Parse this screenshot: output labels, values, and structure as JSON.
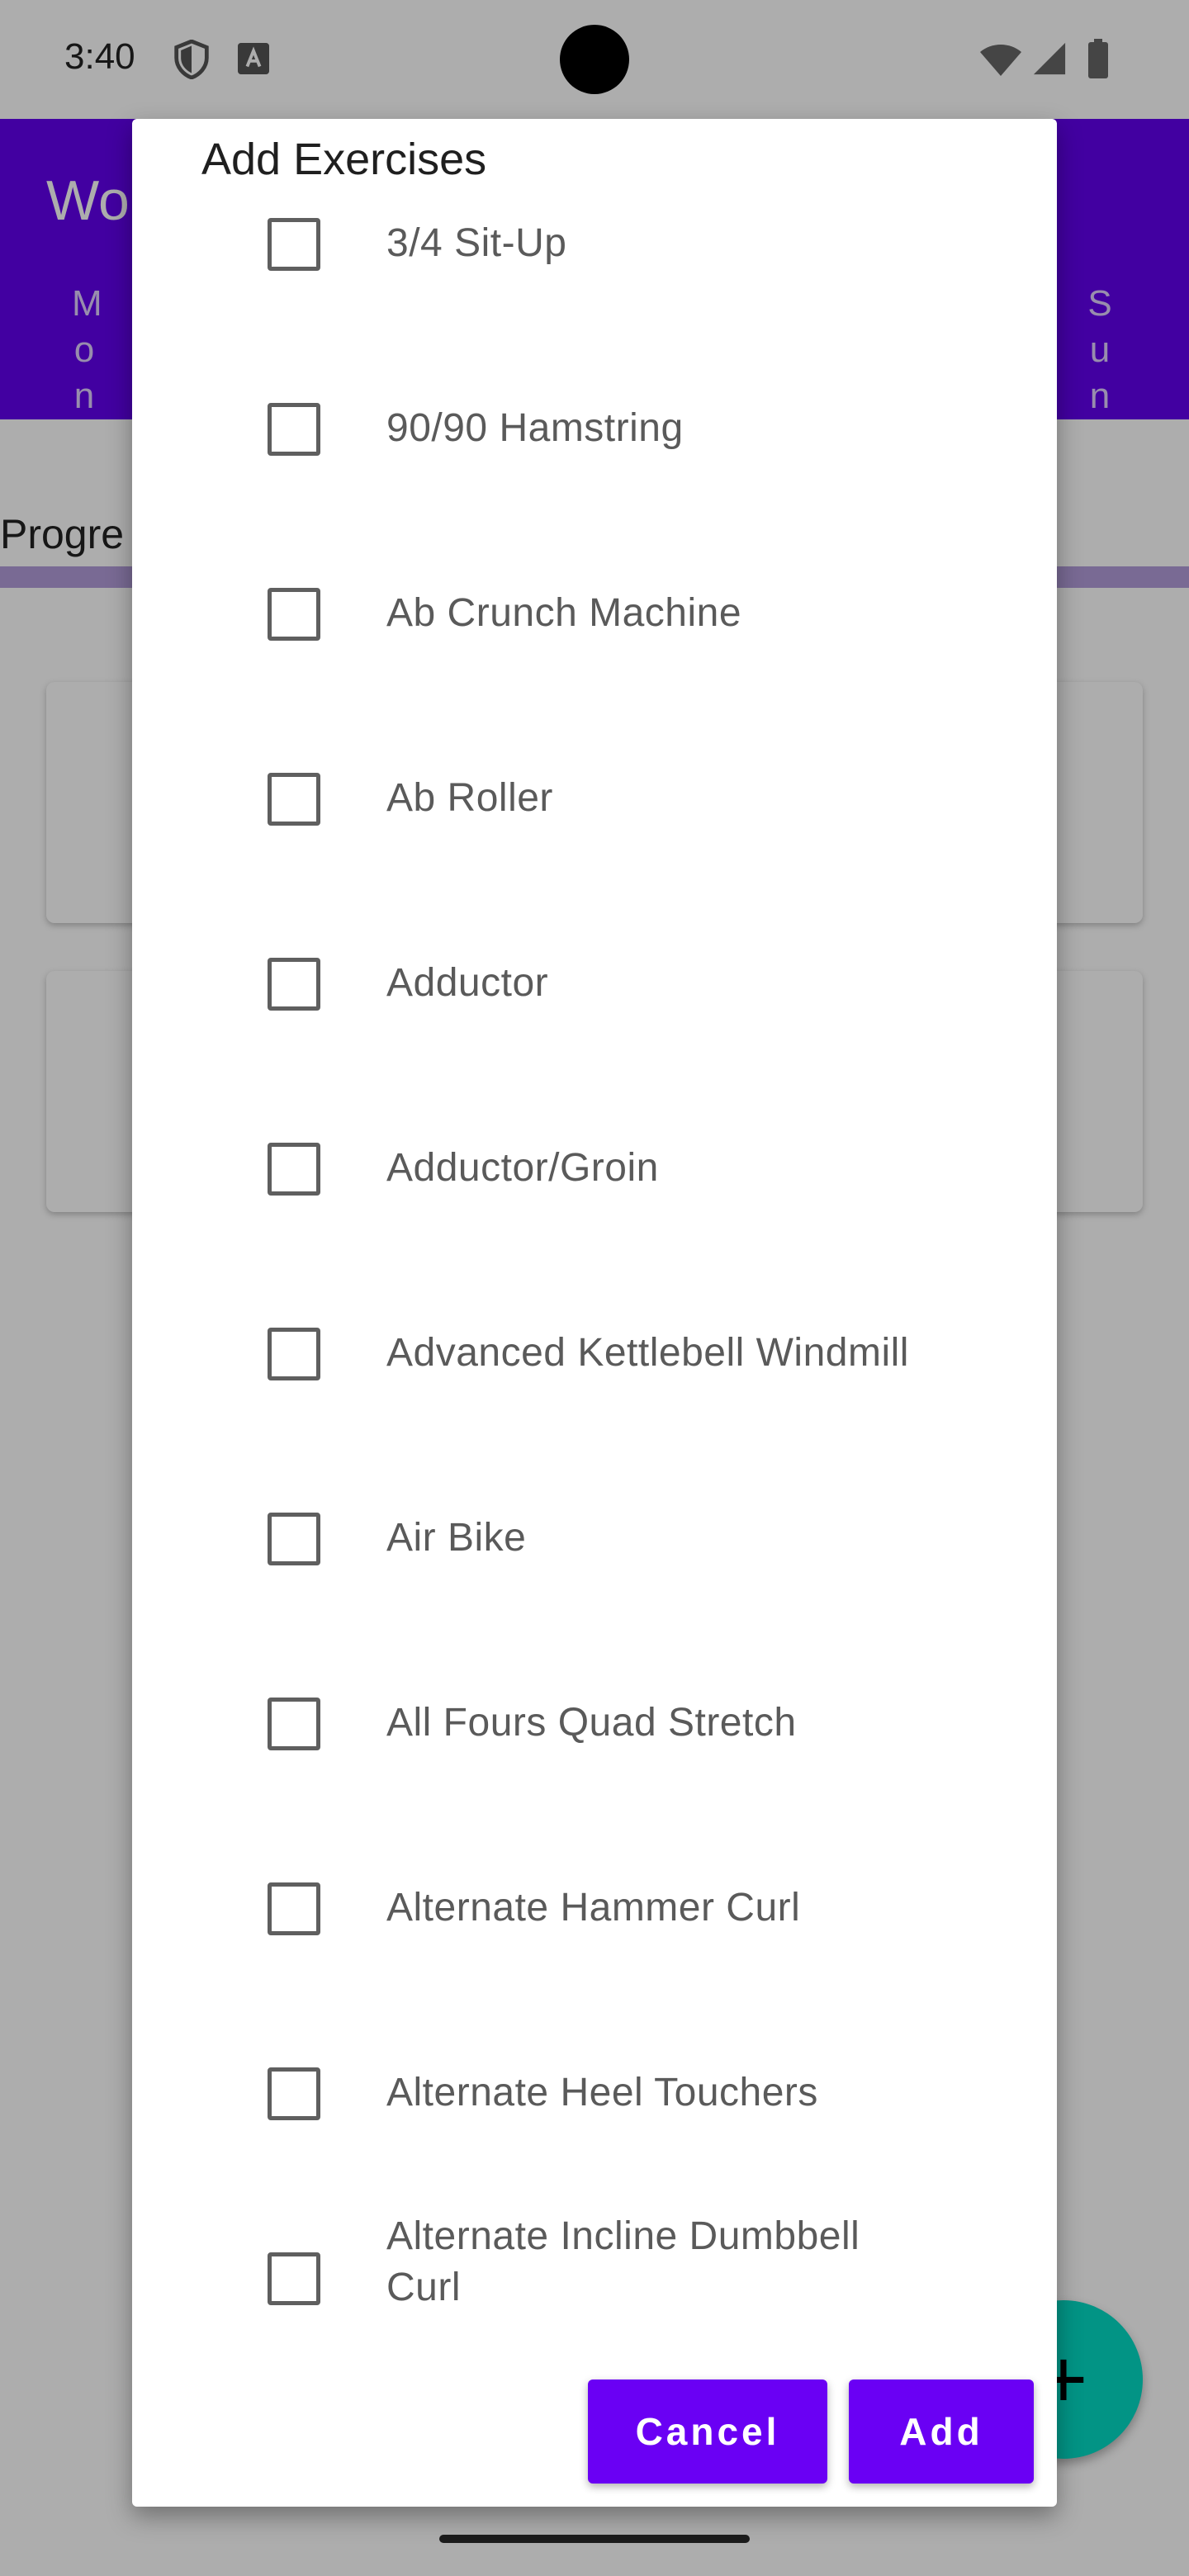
{
  "status_bar": {
    "time": "3:40",
    "icons": [
      "shield-icon",
      "text-a-icon",
      "wifi-icon",
      "signal-icon",
      "battery-icon"
    ]
  },
  "app": {
    "title": "Wo",
    "days": [
      "Mon",
      "Sun"
    ],
    "progress_label": "Progre",
    "colors": {
      "primary": "#6200ee",
      "fab": "#03dac5",
      "progress": "#b39ddb"
    }
  },
  "dialog": {
    "title": "Add Exercises",
    "exercises": [
      {
        "label": "3/4 Sit-Up",
        "checked": false
      },
      {
        "label": "90/90 Hamstring",
        "checked": false
      },
      {
        "label": "Ab Crunch Machine",
        "checked": false
      },
      {
        "label": "Ab Roller",
        "checked": false
      },
      {
        "label": "Adductor",
        "checked": false
      },
      {
        "label": "Adductor/Groin",
        "checked": false
      },
      {
        "label": "Advanced Kettlebell Windmill",
        "checked": false
      },
      {
        "label": "Air Bike",
        "checked": false
      },
      {
        "label": "All Fours Quad Stretch",
        "checked": false
      },
      {
        "label": "Alternate Hammer Curl",
        "checked": false
      },
      {
        "label": "Alternate Heel Touchers",
        "checked": false
      },
      {
        "label": "Alternate Incline Dumbbell Curl",
        "checked": false
      }
    ],
    "cancel_label": "Cancel",
    "add_label": "Add",
    "button_color": "#6a00f4"
  }
}
